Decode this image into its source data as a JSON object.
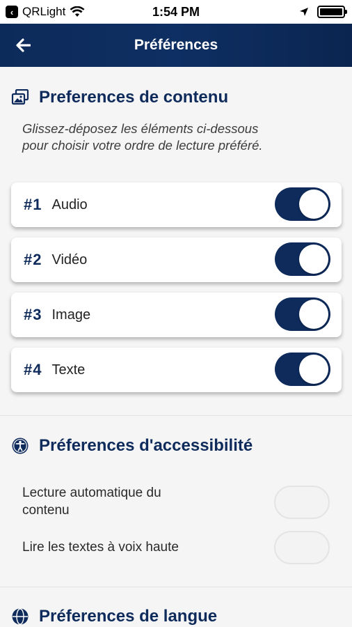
{
  "status_bar": {
    "back_app": "QRLight",
    "time": "1:54 PM"
  },
  "nav": {
    "title": "Préférences"
  },
  "content_section": {
    "title": "Preferences de contenu",
    "subtitle_line1": "Glissez-déposez les éléments ci-dessous",
    "subtitle_line2": "pour choisir votre ordre de lecture préféré.",
    "items": [
      {
        "num": "#1",
        "label": "Audio",
        "enabled": true
      },
      {
        "num": "#2",
        "label": "Vidéo",
        "enabled": true
      },
      {
        "num": "#3",
        "label": "Image",
        "enabled": true
      },
      {
        "num": "#4",
        "label": "Texte",
        "enabled": true
      }
    ]
  },
  "accessibility_section": {
    "title": "Préferences d'accessibilité",
    "options": [
      {
        "label_line1": "Lecture automatique du",
        "label_line2": "contenu",
        "enabled": false
      },
      {
        "label_line1": "Lire les textes à voix haute",
        "label_line2": "",
        "enabled": false
      }
    ]
  },
  "language_section": {
    "title": "Préferences de langue"
  },
  "colors": {
    "primary": "#0e2b5c",
    "background": "#f5f5f5"
  }
}
